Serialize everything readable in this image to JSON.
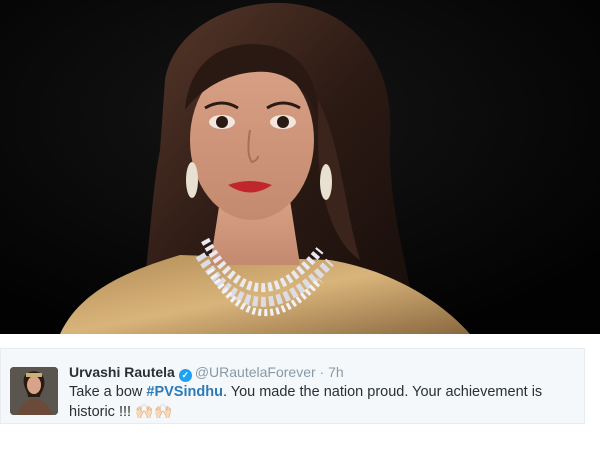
{
  "photo": {
    "icon": "portrait-photo"
  },
  "tweet": {
    "name": "Urvashi Rautela",
    "verified_icon": "verified-badge-icon",
    "handle": "@URautelaForever",
    "separator": "·",
    "time": "7h",
    "text_before": "Take a bow ",
    "hashtag": "#PVSindhu",
    "text_after": ". You made the nation proud. Your achievement is historic !!! ",
    "emoji": "🙌🏻🙌🏻",
    "avatar_icon": "user-avatar"
  },
  "colors": {
    "tweet_bg": "#f5f8fa",
    "name": "#292f33",
    "meta": "#8899a6",
    "hashtag": "#2b7bb9",
    "verified": "#1da1f2"
  }
}
